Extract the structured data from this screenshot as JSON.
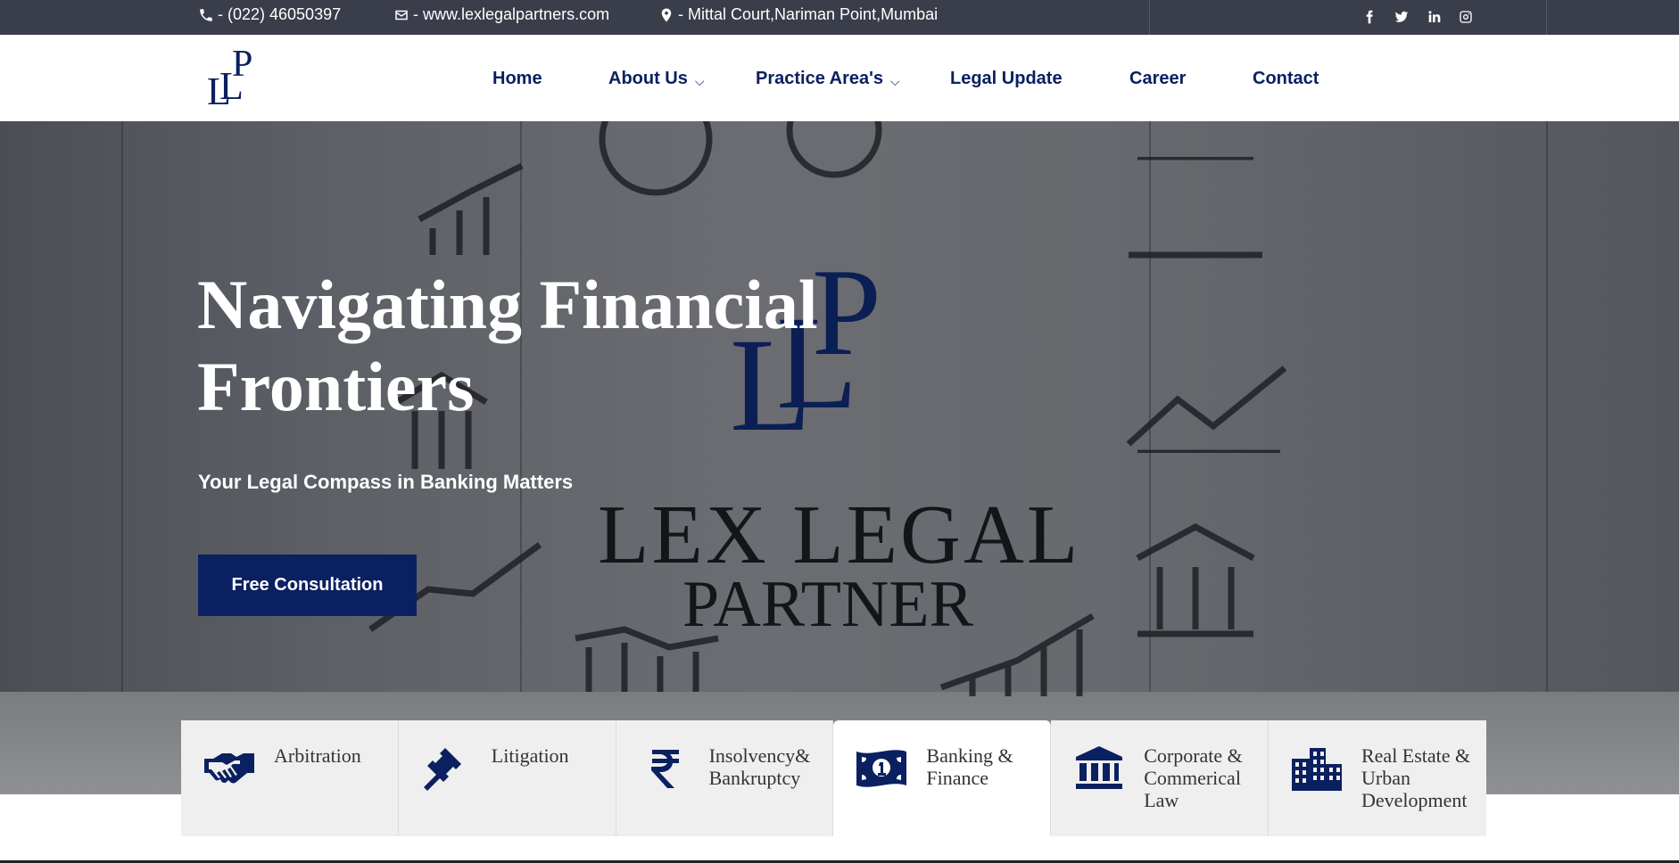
{
  "topbar": {
    "phone": "- (022) 46050397",
    "email": "- www.lexlegalpartners.com",
    "address": "- Mittal Court,Nariman Point,Mumbai",
    "social": [
      "facebook-icon",
      "twitter-icon",
      "linkedin-icon",
      "instagram-icon"
    ]
  },
  "header": {
    "logo_text": "LLP",
    "nav": {
      "home": "Home",
      "about": "About Us",
      "practice": "Practice Area's",
      "legal_update": "Legal Update",
      "career": "Career",
      "contact": "Contact",
      "chevron": "⌵"
    }
  },
  "hero": {
    "title": "Navigating Financial Frontiers",
    "subtitle": "Your Legal Compass in Banking Matters",
    "cta": "Free Consultation",
    "brand_mark": "LLP",
    "brand_line1": "LEX LEGAL",
    "brand_line2": "PARTNER"
  },
  "practice_tabs": [
    {
      "label": "Arbitration",
      "icon": "handshake-icon",
      "active": false
    },
    {
      "label": "Litigation",
      "icon": "gavel-icon",
      "active": false
    },
    {
      "label": "Insolvency& Bankruptcy",
      "icon": "rupee-icon",
      "active": false
    },
    {
      "label": "Banking & Finance",
      "icon": "money-bill-icon",
      "active": true
    },
    {
      "label": "Corporate & Commerical Law",
      "icon": "bank-building-icon",
      "active": false
    },
    {
      "label": "Real Estate & Urban Development",
      "icon": "city-buildings-icon",
      "active": false
    }
  ],
  "colors": {
    "navy": "#0b2060",
    "topbar": "#3a3d4a",
    "tab_bg": "#efefef"
  }
}
